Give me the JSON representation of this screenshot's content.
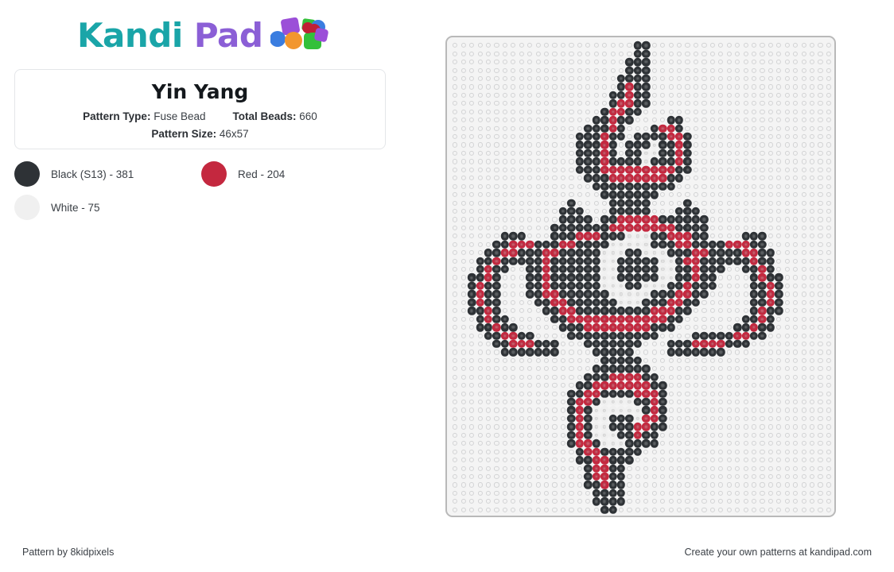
{
  "brand": {
    "name_part1": "Kandi",
    "name_part2": "Pad",
    "color_teal": "#1aa5a8",
    "color_purple": "#8b5fd6"
  },
  "card": {
    "title": "Yin Yang",
    "pattern_type_label": "Pattern Type:",
    "pattern_type_value": "Fuse Bead",
    "total_beads_label": "Total Beads:",
    "total_beads_value": "660",
    "pattern_size_label": "Pattern Size:",
    "pattern_size_value": "46x57"
  },
  "legend": {
    "items": [
      {
        "label": "Black (S13) - 381",
        "color": "#2e3236",
        "name": "Black (S13)",
        "count": 381
      },
      {
        "label": "Red - 204",
        "color": "#c4283f",
        "name": "Red",
        "count": 204
      },
      {
        "label": "White - 75",
        "color": "#f0f0f0",
        "name": "White",
        "count": 75
      }
    ]
  },
  "footer": {
    "left": "Pattern by 8kidpixels",
    "right": "Create your own patterns at kandipad.com"
  },
  "pattern": {
    "columns": 46,
    "rows": 57,
    "palette": {
      "K": "#2e3236",
      "R": "#c4283f",
      "W": "#f0f0f0",
      ".": "empty"
    },
    "grid": [
      "......................KK......................",
      "......................KK......................",
      ".....................KKK......................",
      ".....................KKK......................",
      "....................KKKK......................",
      "....................KRKK......................",
      "...................KKRKK......................",
      "...................KRRKK......................",
      "..................KRRKK.......................",
      ".................KKRKK....KK..................",
      "................KKKRK...KRRK..................",
      "...............KKKRKK.KKKKRRK.................",
      "...............KKKRK.KKKWKKRK.................",
      "...............KKKRK.KKWWKKRK.................",
      "...............KKKRKKKKWKKKRK.................",
      "...............KKKRRRRRRRRRKK.................",
      "................KKKRRRRRRRKK..................",
      ".................KKKKKKKKKK...................",
      "..................KKKKKKK.....................",
      "..............K....KKKKK....K.................",
      ".............KKK...KKKKK...KKK................",
      ".............KKKK.KKRRRRRKKKKKK...............",
      "............KKKKKKKRRRRRRRRKKKK...............",
      "......KKK...KKKRRRKKKWWWKKRRRKK....KKK........",
      ".....KKRRRKKKRRKKKKWWWWWKKKRRKKKKRRRKK........",
      "....KKRRKKKRRKKKKKWWWKKWWWKKKRRKKKKRRKK.......",
      "...KKRKKKKKRKKKKKKWWKKKKKWWKRRKKKKKKRKK.......",
      "...KRKK..KKRKKKKKKWWKKKKKWWKKRKKK..KKRK.......",
      "..KKRK...KKRKKKKKKWWKKKKKWWKKRKK....KRKK......",
      "..KRKK...KKRKKKKKKWWWKKWWWKKRKKK....KKRK......",
      "..KRKK...KKRRKKKKKKWWWWWKKKRRKK.....KKRK......",
      "..KRKK....KKRRKKKKKKWWWKKKRRKK......KKRK......",
      "..KKRK.....KKRRKKKKKKKKKRRRKK.......KRKK......",
      "...KRKK.....KKRRRRRRRRRRRRKK.......KKRK.......",
      "...KKRKK.....KKKRRRRRRRRKKK.......KKRKK.......",
      "....KKRRKK....KKKKKKKKKKK....KKKKKRRKK........",
      ".....KKRRRKKK...KKKKKKK...KKKRRRRKKK..........",
      "......KKKKKKK....KKKKK....KKKKKKK.............",
      "..................KKKKK.......................",
      ".................KKKKKKK......................",
      "................KKKRRRRKK.....................",
      "...............KKRRRRRRRKK....................",
      "..............KKRRKKKKRRRK....................",
      "..............KRRKWWWWKKRK....................",
      "..............KRKWWWWWWKRK....................",
      "..............KRKWWKKKWRRK....................",
      "..............KRKWWKKKRRKK....................",
      "..............KRKWWWKKRKK.....................",
      "..............KRRKWWWKKKK.....................",
      "...............KRRKKKKK.......................",
      "...............KKRRKKK........................",
      "................KRRKK.........................",
      "................KRRKK.........................",
      "................KKRKK.........................",
      ".................KKKK.........................",
      ".................KKKK.........................",
      "..................KK.........................."
    ]
  }
}
